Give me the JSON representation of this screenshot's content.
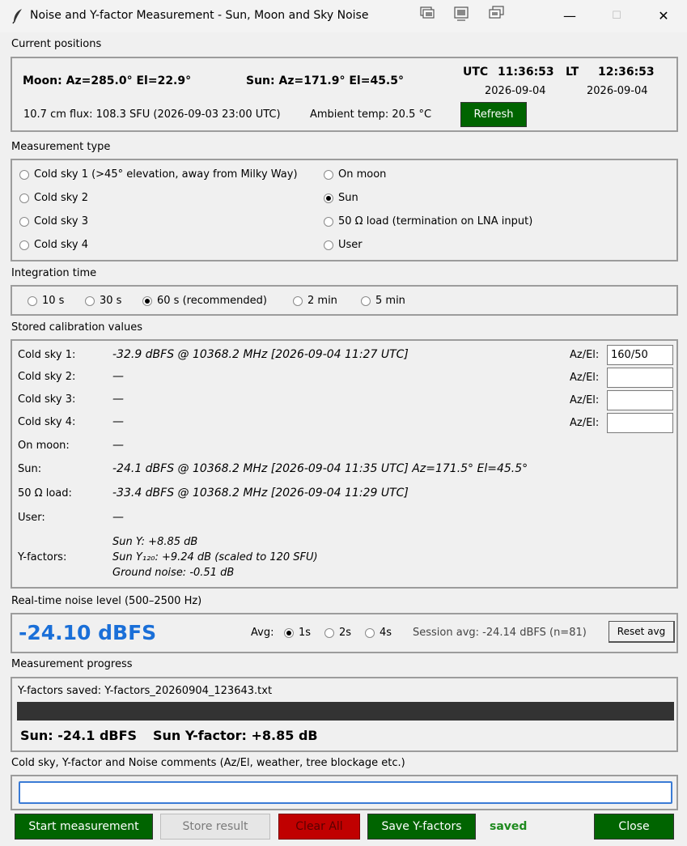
{
  "window": {
    "title": "Noise and Y-factor Measurement -  Sun, Moon and Sky Noise",
    "minimize_glyph": "—",
    "maximize_glyph": "☐",
    "close_glyph": "✕"
  },
  "current_positions": {
    "section_label": "Current positions",
    "moon": "Moon: Az=285.0°  El=22.9°",
    "sun": "Sun: Az=171.9°  El=45.5°",
    "utc_label": "UTC",
    "utc_time": "11:36:53",
    "utc_date": "2026-09-04",
    "lt_label": "LT",
    "lt_time": "12:36:53",
    "lt_date": "2026-09-04",
    "flux": "10.7 cm flux: 108.3 SFU  (2026-09-03 23:00 UTC)",
    "ambient": "Ambient temp: 20.5 °C",
    "refresh_label": "Refresh"
  },
  "measurement_type": {
    "section_label": "Measurement type",
    "options": [
      {
        "label": "Cold sky 1  (>45° elevation, away from Milky Way)",
        "selected": false
      },
      {
        "label": "Cold sky 2",
        "selected": false
      },
      {
        "label": "Cold sky 3",
        "selected": false
      },
      {
        "label": "Cold sky 4",
        "selected": false
      },
      {
        "label": "On moon",
        "selected": false
      },
      {
        "label": "Sun",
        "selected": true
      },
      {
        "label": "50 Ω load  (termination on LNA input)",
        "selected": false
      },
      {
        "label": "User",
        "selected": false
      }
    ]
  },
  "integration_time": {
    "section_label": "Integration time",
    "options": [
      {
        "label": "10 s",
        "selected": false
      },
      {
        "label": "30 s",
        "selected": false
      },
      {
        "label": "60 s  (recommended)",
        "selected": true
      },
      {
        "label": "2 min",
        "selected": false
      },
      {
        "label": "5 min",
        "selected": false
      }
    ]
  },
  "stored_values": {
    "section_label": "Stored calibration values",
    "rows": [
      {
        "label": "Cold sky 1:",
        "value": "-32.9 dBFS  @ 10368.2 MHz  [2026-09-04 11:27 UTC]"
      },
      {
        "label": "Cold sky 2:",
        "value": "—"
      },
      {
        "label": "Cold sky 3:",
        "value": "—"
      },
      {
        "label": "Cold sky 4:",
        "value": "—"
      },
      {
        "label": "On moon:",
        "value": "—"
      },
      {
        "label": "Sun:",
        "value": "-24.1 dBFS  @ 10368.2 MHz  [2026-09-04 11:35 UTC]  Az=171.5° El=45.5°"
      },
      {
        "label": "50 Ω load:",
        "value": "-33.4 dBFS  @ 10368.2 MHz  [2026-09-04 11:29 UTC]"
      },
      {
        "label": "User:",
        "value": "—"
      }
    ],
    "azel_label": "Az/El:",
    "azel_values": [
      "160/50",
      "",
      "",
      ""
    ],
    "yfactors_label": "Y-factors:",
    "yfactors_lines": [
      "Sun Y: +8.85 dB",
      "Sun Y₁₂₀: +9.24 dB  (scaled to 120 SFU)",
      "Ground noise: -0.51 dB"
    ]
  },
  "realtime": {
    "section_label": "Real-time noise level  (500–2500 Hz)",
    "level": "-24.10 dBFS",
    "avg_label": "Avg:",
    "avg_options": [
      {
        "label": "1s",
        "selected": true
      },
      {
        "label": "2s",
        "selected": false
      },
      {
        "label": "4s",
        "selected": false
      }
    ],
    "session_avg": "Session avg: -24.14 dBFS  (n=81)",
    "reset_label": "Reset avg",
    "level_color": "#1a6fd8"
  },
  "progress": {
    "section_label": "Measurement progress",
    "status": "Y-factors saved: Y-factors_20260904_123643.txt",
    "progress_fraction": 1.0,
    "sun_result": "Sun: -24.1 dBFS",
    "yfactor_result": "Sun Y-factor: +8.85 dB"
  },
  "comments": {
    "section_label": "Cold sky, Y-factor and Noise comments  (Az/El, weather, tree blockage etc.)",
    "value": ""
  },
  "buttons": {
    "start": "Start measurement",
    "store": "Store result",
    "clear": "Clear All",
    "save": "Save Y-factors",
    "saved_status": "saved",
    "close": "Close"
  },
  "colors": {
    "green_button": "#006400",
    "red_button": "#c00000",
    "saved_text": "#1e8a1e"
  }
}
